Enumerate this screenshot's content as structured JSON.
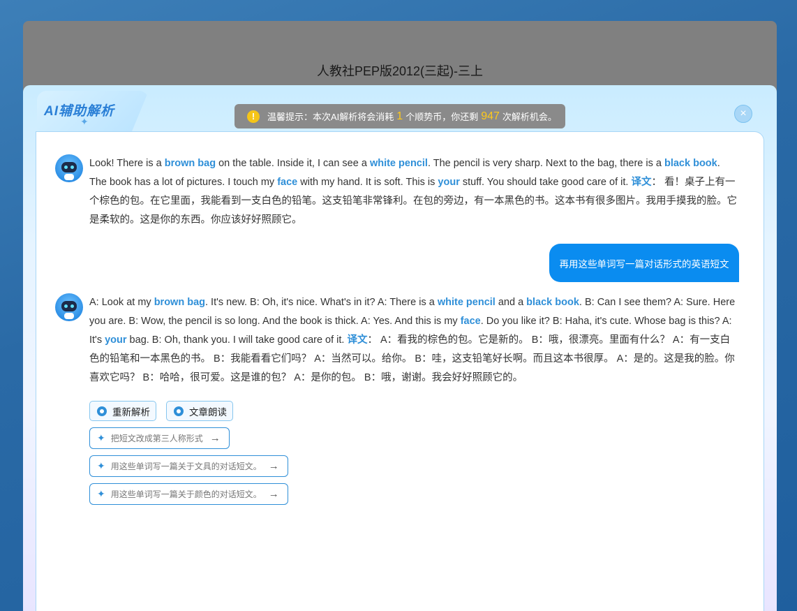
{
  "background": {
    "title": "人教社PEP版2012(三起)-三上"
  },
  "modal": {
    "tab_label": "AI辅助解析",
    "notice": {
      "prefix": "温馨提示：本次AI解析将会消耗",
      "cost": "1",
      "middle": "个顺势币，你还剩",
      "remaining": "947",
      "suffix": "次解析机会。"
    },
    "close_label": "×"
  },
  "messages": {
    "ai1": {
      "segments": [
        {
          "t": "Look! There is a "
        },
        {
          "t": "brown bag",
          "kw": true
        },
        {
          "t": " on the table. Inside it, I can see a "
        },
        {
          "t": "white pencil",
          "kw": true
        },
        {
          "t": ". The pencil is very sharp. Next to the bag, there is a "
        },
        {
          "t": "black book",
          "kw": true
        },
        {
          "t": ". The book has a lot of pictures. I touch my "
        },
        {
          "t": "face",
          "kw": true
        },
        {
          "t": " with my hand. It is soft. This is "
        },
        {
          "t": "your",
          "kw": true
        },
        {
          "t": " stuff. You should take good care of it. "
        },
        {
          "t": "译文",
          "kw": true
        },
        {
          "t": "：  看！桌子上有一个棕色的包。在它里面，我能看到一支白色的铅笔。这支铅笔非常锋利。在包的旁边，有一本黑色的书。这本书有很多图片。我用手摸我的脸。它是柔软的。这是你的东西。你应该好好照顾它。"
        }
      ]
    },
    "user": {
      "text": "再用这些单词写一篇对话形式的英语短文"
    },
    "ai2": {
      "segments": [
        {
          "t": "A: Look at my "
        },
        {
          "t": "brown bag",
          "kw": true
        },
        {
          "t": ". It's new. B: Oh, it's nice. What's in it? A: There is a "
        },
        {
          "t": "white pencil",
          "kw": true
        },
        {
          "t": " and a "
        },
        {
          "t": "black book",
          "kw": true
        },
        {
          "t": ". B: Can I see them? A: Sure. Here you are. B: Wow, the pencil is so long. And the book is thick. A: Yes. And this is my "
        },
        {
          "t": "face",
          "kw": true
        },
        {
          "t": ". Do you like it? B: Haha, it's cute. Whose bag is this? A: It's "
        },
        {
          "t": "your",
          "kw": true
        },
        {
          "t": " bag. B: Oh, thank you. I will take good care of it. "
        },
        {
          "t": "译文",
          "kw": true
        },
        {
          "t": "：  A：看我的棕色的包。它是新的。 B：哦，很漂亮。里面有什么？ A：有一支白色的铅笔和一本黑色的书。 B：我能看看它们吗？ A：当然可以。给你。 B：哇，这支铅笔好长啊。而且这本书很厚。 A：是的。这是我的脸。你喜欢它吗？ B：哈哈，很可爱。这是谁的包？ A：是你的包。 B：哦，谢谢。我会好好照顾它的。"
        }
      ]
    }
  },
  "actions": {
    "reanalyze": "重新解析",
    "read_aloud": "文章朗读"
  },
  "suggestions": [
    "把短文改成第三人称形式",
    "用这些单词写一篇关于文具的对话短文。",
    "用这些单词写一篇关于颜色的对话短文。"
  ]
}
